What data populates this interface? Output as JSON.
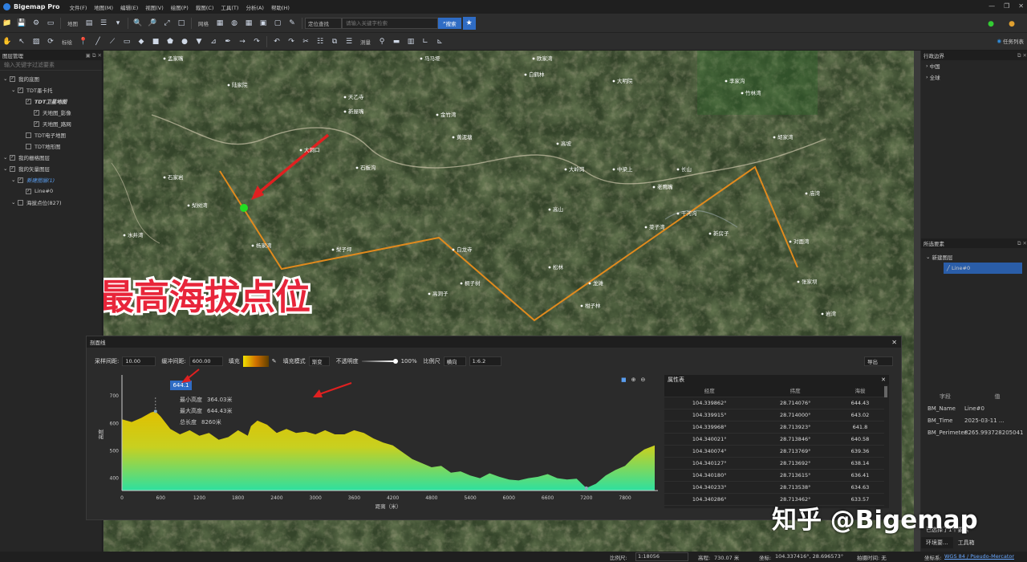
{
  "app": {
    "title": "Bigemap Pro"
  },
  "menu": [
    "文件(F)",
    "地图(M)",
    "编辑(E)",
    "视图(V)",
    "绘图(P)",
    "裁图(C)",
    "工具(T)",
    "分析(A)",
    "帮助(H)"
  ],
  "toolbar": {
    "map_label": "地图",
    "grid_label": "网格",
    "search_category": "定位查找",
    "search_placeholder": "请输入关键字检索",
    "search_button": "搜索",
    "mark_label": "标绘",
    "analysis_label": "测量",
    "task_list": "任务列表"
  },
  "layers_panel": {
    "title": "图层管理",
    "filter_placeholder": "输入关键字过滤要素",
    "items": [
      {
        "label": "我的底图",
        "indent": 0,
        "check": true
      },
      {
        "label": "TDT墨卡托",
        "indent": 1,
        "check": true
      },
      {
        "label": "TDT卫星地图",
        "indent": 2,
        "check": true
      },
      {
        "label": "天地图_影像",
        "indent": 3,
        "check": true
      },
      {
        "label": "天地图_路网",
        "indent": 3,
        "check": true
      },
      {
        "label": "TDT电子地图",
        "indent": 2,
        "check": false
      },
      {
        "label": "TDT地形图",
        "indent": 2,
        "check": false
      },
      {
        "label": "我的栅格图层",
        "indent": 0,
        "check": true
      },
      {
        "label": "我的矢量图层",
        "indent": 0,
        "check": true
      },
      {
        "label": "新建图层(1)",
        "indent": 1,
        "check": true
      },
      {
        "label": "Line#0",
        "indent": 2,
        "check": true
      },
      {
        "label": "海拔点位(827)",
        "indent": 1,
        "check": false
      }
    ]
  },
  "region_panel": {
    "title": "行政边界",
    "items": [
      "中国",
      "全球"
    ]
  },
  "selected_panel": {
    "title": "所选要素",
    "group": "新建图层",
    "item": "Line#0"
  },
  "field_table": {
    "headers": [
      "字段",
      "值"
    ],
    "rows": [
      [
        "BM_Name",
        "Line#0"
      ],
      [
        "BM_Time",
        "2025-03-11 ..."
      ],
      [
        "BM_Perimeter",
        "8265.993728205041"
      ]
    ],
    "footer": "已选择了1个要素"
  },
  "right_tabs": [
    "环境要...",
    "工具箱"
  ],
  "overlay_caption": "最高海拔点位",
  "watermark": "知乎 @Bigemap",
  "map_labels": [
    "马马垭",
    "孟家嘴",
    "欧家湾",
    "白鹤林",
    "大明院",
    "天乙寺",
    "陆家院",
    "新屋嘴",
    "金竹湾",
    "黄泥塘",
    "高坡",
    "大岭岗",
    "中梁上",
    "石板沟",
    "李家沟",
    "大洞口",
    "竹林湾",
    "胡家湾",
    "长山",
    "老鹰嘴",
    "梨树湾",
    "菜子湾",
    "对面湾",
    "新房子",
    "杨家湾",
    "龙滩",
    "张家坝",
    "松林",
    "桐子树",
    "水井湾",
    "石家岩",
    "马鞍山",
    "高洞子",
    "干河沟",
    "岩湾",
    "白龙寺",
    "梨子坪",
    "高山",
    "柑子林",
    "庙湾"
  ],
  "profile": {
    "title": "剖面线",
    "sample_label": "采样间距:",
    "sample_value": "10.00",
    "hbuf_label": "缓冲间距:",
    "hbuf_value": "600.00",
    "fill_label": "填充",
    "fill_mode_label": "填充模式",
    "fill_mode_value": "渐变",
    "opacity_label": "不透明度",
    "opacity_value": "100%",
    "scale_label": "比例尺",
    "scale_mode": "横向",
    "scale_value": "1:6.2",
    "export_label": "导出",
    "peak_label": "644.1",
    "stats": [
      {
        "label": "最小高度",
        "value": "364.03米"
      },
      {
        "label": "最大高度",
        "value": "644.43米"
      },
      {
        "label": "总长度",
        "value": "8260米"
      }
    ],
    "attr_title": "属性表",
    "attr_headers": [
      "经度",
      "纬度",
      "海拔"
    ],
    "attr_rows": [
      [
        "104.339862°",
        "28.714076°",
        "644.43"
      ],
      [
        "104.339915°",
        "28.714000°",
        "643.02"
      ],
      [
        "104.339968°",
        "28.713923°",
        "641.8"
      ],
      [
        "104.340021°",
        "28.713846°",
        "640.58"
      ],
      [
        "104.340074°",
        "28.713769°",
        "639.36"
      ],
      [
        "104.340127°",
        "28.713692°",
        "638.14"
      ],
      [
        "104.340180°",
        "28.713615°",
        "636.41"
      ],
      [
        "104.340233°",
        "28.713538°",
        "634.63"
      ],
      [
        "104.340286°",
        "28.713462°",
        "633.57"
      ]
    ]
  },
  "chart_data": {
    "type": "area",
    "title": "",
    "xlabel": "距离（米）",
    "ylabel": "高度",
    "xlim": [
      0,
      8260
    ],
    "ylim": [
      355,
      765
    ],
    "xticks": [
      0,
      600,
      1200,
      1800,
      2400,
      3000,
      3600,
      4200,
      4800,
      5400,
      6000,
      6600,
      7200,
      7800
    ],
    "yticks": [
      400,
      500,
      600,
      700
    ],
    "x": [
      0,
      150,
      300,
      450,
      520,
      600,
      750,
      900,
      1050,
      1200,
      1350,
      1500,
      1650,
      1800,
      1950,
      2000,
      2100,
      2250,
      2400,
      2550,
      2700,
      2850,
      3000,
      3150,
      3300,
      3450,
      3600,
      3750,
      3900,
      4050,
      4200,
      4350,
      4500,
      4650,
      4800,
      4950,
      5100,
      5250,
      5400,
      5550,
      5700,
      5850,
      6000,
      6150,
      6300,
      6450,
      6600,
      6750,
      6900,
      7050,
      7200,
      7350,
      7500,
      7650,
      7800,
      7950,
      8100,
      8260
    ],
    "y": [
      615,
      605,
      620,
      640,
      644,
      625,
      580,
      560,
      575,
      555,
      565,
      540,
      550,
      575,
      555,
      590,
      610,
      595,
      565,
      580,
      565,
      570,
      560,
      575,
      560,
      560,
      575,
      565,
      545,
      530,
      520,
      495,
      470,
      455,
      440,
      445,
      420,
      425,
      410,
      400,
      418,
      405,
      395,
      392,
      400,
      405,
      415,
      400,
      395,
      398,
      364,
      380,
      410,
      430,
      445,
      480,
      505,
      520
    ]
  },
  "status": {
    "scale_label": "比例尺:",
    "scale_value": "1:18056",
    "elev_label": "高程:",
    "elev_value": "730.07 米",
    "coord_label": "坐标:",
    "coord_value": "104.337416°, 28.696573°",
    "time_label": "拍摄时间: 无",
    "crs_label": "坐标系:",
    "crs_value": "WGS 84 / Pseudo-Mercator"
  },
  "colors": {
    "accent": "#2f6cc4",
    "route": "#e08a1e",
    "caption_red": "#e8253a",
    "arrow_red": "#e02020",
    "fill_top": "#e0c000",
    "fill_bottom": "#2de0a0"
  }
}
